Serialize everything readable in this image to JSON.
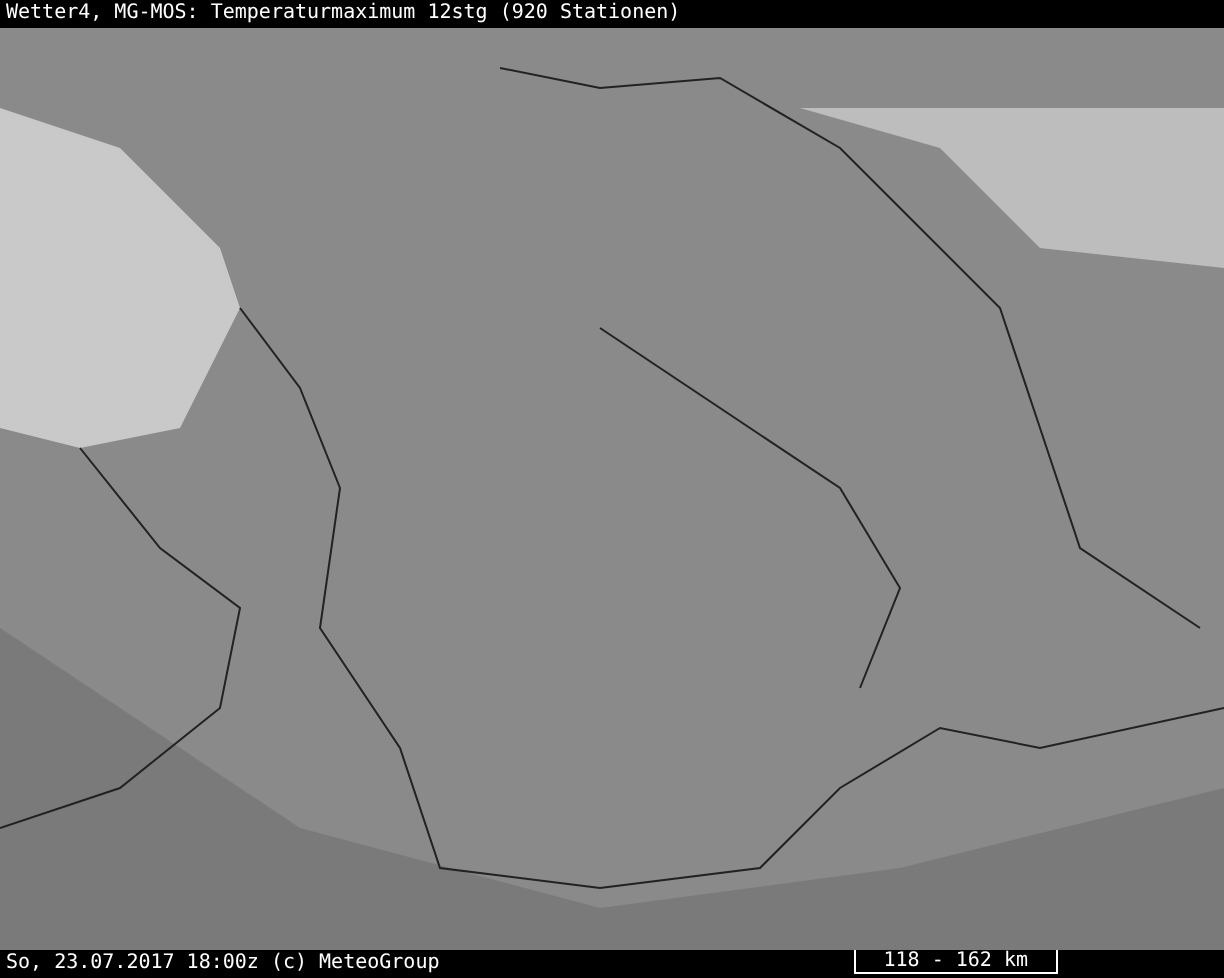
{
  "title_bar": {
    "title": "Wetter4, MG-MOS: Temperaturmaximum 12stg (920 Stationen)"
  },
  "status_bar": {
    "timestamp": "So, 23.07.2017 18:00z (c) MeteoGroup",
    "scale": "118 - 162 km"
  }
}
